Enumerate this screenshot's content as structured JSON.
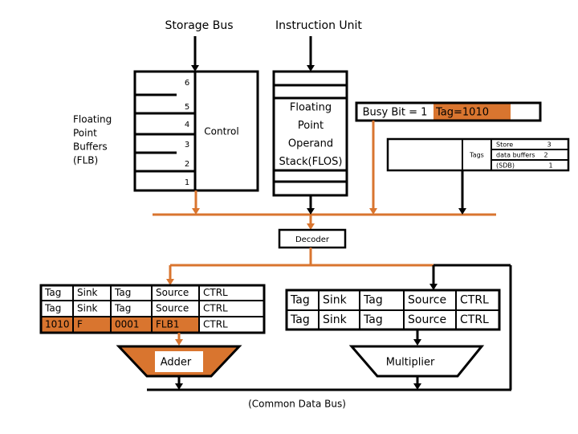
{
  "labels": {
    "storage_bus": "Storage Bus",
    "instruction_unit": "Instruction Unit",
    "flb": [
      "Floating",
      "Point",
      "Buffers",
      "(FLB)"
    ],
    "control": "Control",
    "flb_numbers": [
      "6",
      "5",
      "4",
      "3",
      "2",
      "1"
    ],
    "flos": [
      "Floating",
      "Point",
      "Operand",
      "Stack(FLOS)"
    ],
    "busy_bit": "Busy Bit = 1",
    "tag_value": "Tag=1010",
    "tags": "Tags",
    "sdb": [
      [
        "Store",
        "3"
      ],
      [
        "data buffers",
        "2"
      ],
      [
        "(SDB)",
        "1"
      ]
    ],
    "decoder": "Decoder",
    "adder": "Adder",
    "multiplier": "Multiplier",
    "cdb": "(Common Data Bus)"
  },
  "adder_station": [
    [
      "Tag",
      "Sink",
      "Tag",
      "Source",
      "CTRL"
    ],
    [
      "Tag",
      "Sink",
      "Tag",
      "Source",
      "CTRL"
    ],
    [
      "1010",
      "F",
      "0001",
      "FLB1",
      "CTRL"
    ]
  ],
  "multiplier_station": [
    [
      "Tag",
      "Sink",
      "Tag",
      "Source",
      "CTRL"
    ],
    [
      "Tag",
      "Sink",
      "Tag",
      "Source",
      "CTRL"
    ]
  ],
  "colors": {
    "accent": "#d9752f",
    "line": "#000000"
  }
}
